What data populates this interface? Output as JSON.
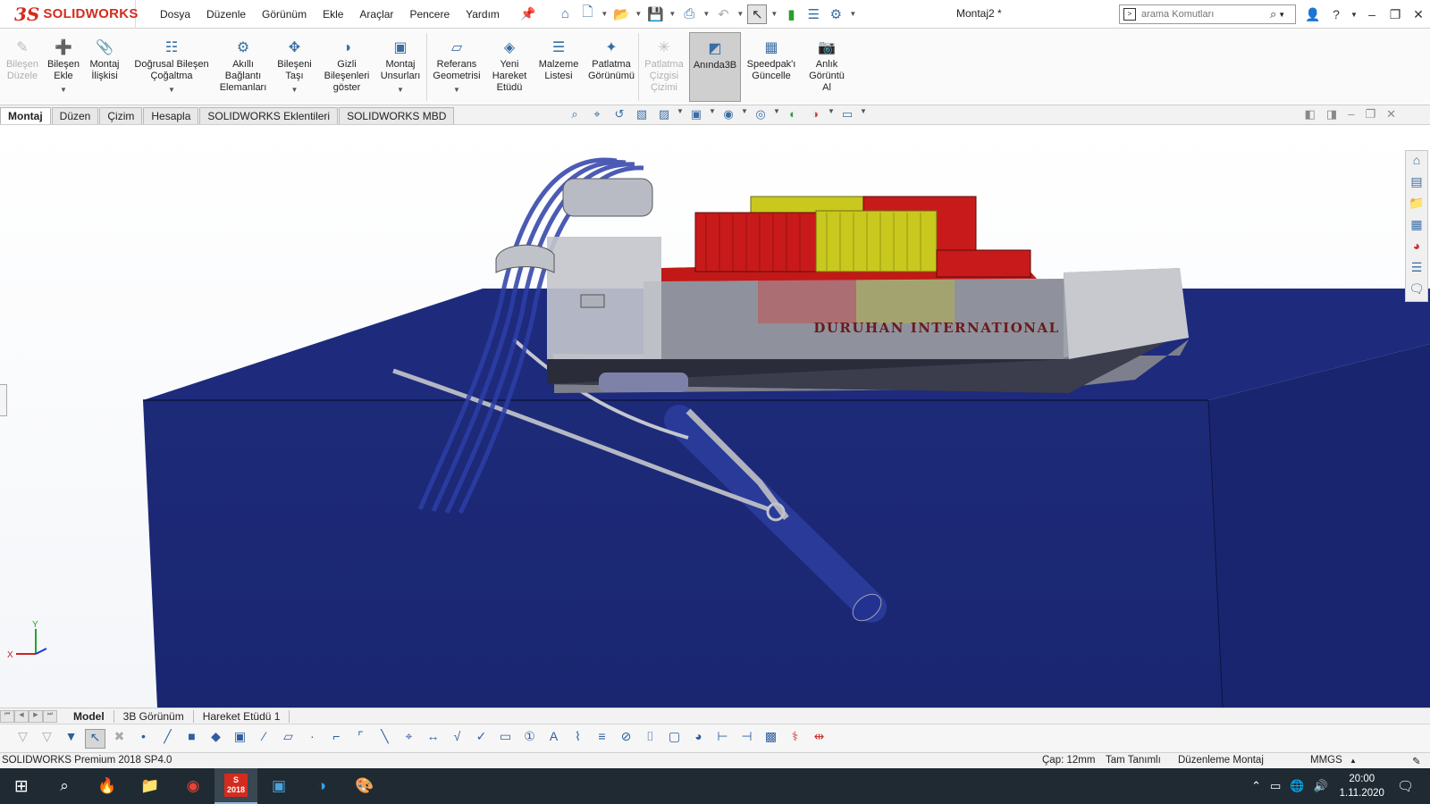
{
  "app": {
    "logo_ds": "3S",
    "logo_text": "SOLIDWORKS",
    "document_title": "Montaj2 *"
  },
  "menu": [
    "Dosya",
    "Düzenle",
    "Görünüm",
    "Ekle",
    "Araçlar",
    "Pencere",
    "Yardım"
  ],
  "search": {
    "placeholder": "arama Komutları"
  },
  "commands": [
    {
      "label": "Bileşen\nDüzele",
      "icon": "edit-component-icon",
      "disabled": true
    },
    {
      "label": "Bileşen\nEkle",
      "icon": "insert-component-icon",
      "dropdown": true
    },
    {
      "label": "Montaj\nİlişkisi",
      "icon": "mate-icon"
    },
    {
      "label": "Doğrusal Bileşen\nÇoğaltma",
      "icon": "linear-pattern-icon",
      "dropdown": true
    },
    {
      "label": "Akıllı\nBağlantı\nElemanları",
      "icon": "smart-fasteners-icon"
    },
    {
      "label": "Bileşeni\nTaşı",
      "icon": "move-component-icon",
      "dropdown": true
    },
    {
      "label": "Gizli\nBileşenleri\ngöster",
      "icon": "show-hidden-icon"
    },
    {
      "label": "Montaj\nUnsurları",
      "icon": "assembly-features-icon",
      "dropdown": true
    },
    {
      "label": "Referans\nGeometrisi",
      "icon": "reference-geometry-icon",
      "dropdown": true
    },
    {
      "label": "Yeni\nHareket\nEtüdü",
      "icon": "motion-study-icon"
    },
    {
      "label": "Malzeme\nListesi",
      "icon": "bom-icon"
    },
    {
      "label": "Patlatma\nGörünümü",
      "icon": "exploded-view-icon"
    },
    {
      "label": "Patlatma\nÇizgisi\nÇizimi",
      "icon": "explode-line-icon",
      "disabled": true
    },
    {
      "label": "Anında3B",
      "icon": "instant3d-icon",
      "active": true
    },
    {
      "label": "Speedpak'ı\nGüncelle",
      "icon": "speedpak-icon"
    },
    {
      "label": "Anlık\nGörüntü\nAl",
      "icon": "snapshot-icon"
    }
  ],
  "tabs": [
    {
      "label": "Montaj",
      "selected": true
    },
    {
      "label": "Düzen"
    },
    {
      "label": "Çizim"
    },
    {
      "label": "Hesapla"
    },
    {
      "label": "SOLIDWORKS Eklentileri"
    },
    {
      "label": "SOLIDWORKS MBD"
    }
  ],
  "model_text": {
    "hull_lettering": "DURUHAN INTERNATIONAL"
  },
  "model_tabs": [
    {
      "label": "Model",
      "selected": true
    },
    {
      "label": "3B Görünüm"
    },
    {
      "label": "Hareket Etüdü 1"
    }
  ],
  "status": {
    "product": "SOLIDWORKS Premium 2018 SP4.0",
    "radius": "Çap: 12mm",
    "definition": "Tam Tanımlı",
    "mode": "Düzenleme Montaj",
    "units": "MMGS"
  },
  "triad": {
    "x": "X",
    "y": "Y"
  },
  "clock": {
    "time": "20:00",
    "date": "1.11.2020"
  },
  "taskbar_sw_badge": "2018",
  "colors": {
    "water": "#1d2a78",
    "container_red": "#c81a1a",
    "container_yellow": "#c9c81e",
    "hull": "#9a9ea8",
    "brand_red": "#d52b1e"
  }
}
